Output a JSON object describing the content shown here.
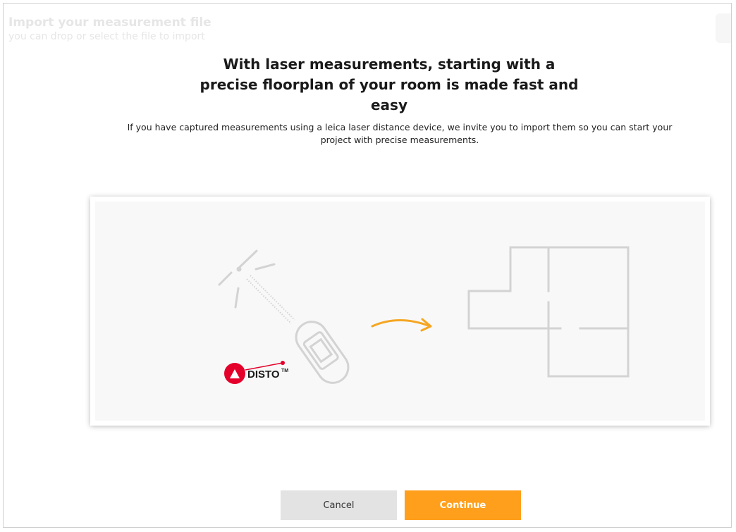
{
  "header": {
    "title": "Import your measurement file",
    "subtitle": "you can drop or select the file to import"
  },
  "main": {
    "heading": "With laser measurements, starting with a precise floorplan of your room is made fast and easy",
    "description": "If you have captured measurements using a leica laser distance device, we invite you to import them so you can start your project with precise measurements."
  },
  "illustration": {
    "brand_text": "DISTO",
    "brand_trademark": "TM",
    "colors": {
      "arrow": "#f5a623",
      "brand": "#e4002b",
      "line": "#d3d3d3"
    }
  },
  "footer": {
    "cancel_label": "Cancel",
    "continue_label": "Continue"
  },
  "colors": {
    "accent": "#ff9f1c",
    "cancel_bg": "#e3e3e3"
  }
}
